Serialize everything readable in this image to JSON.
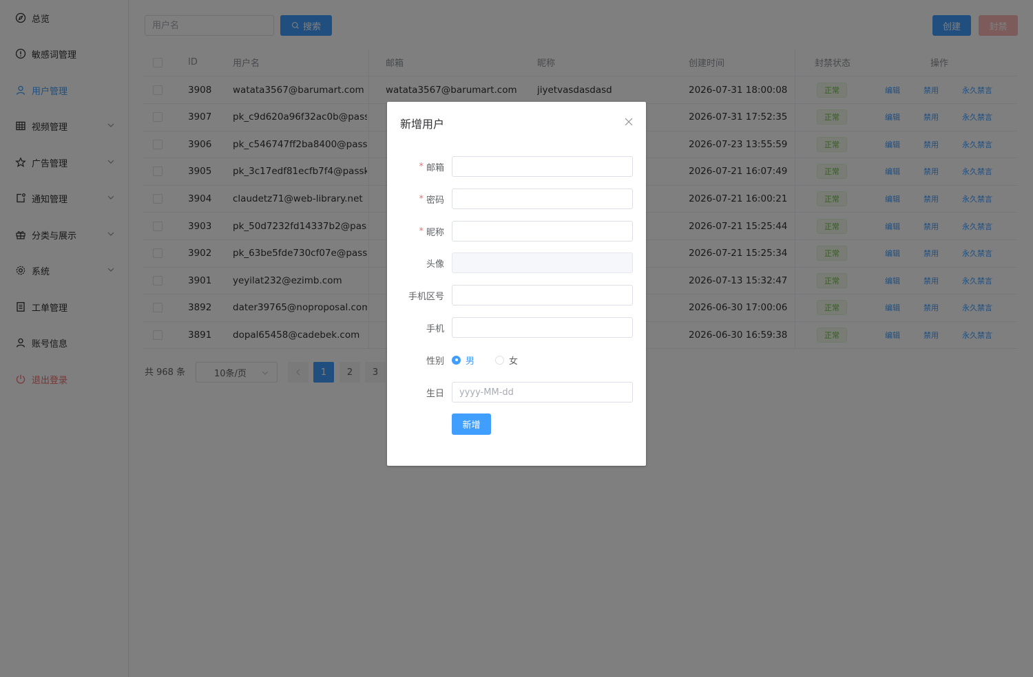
{
  "sidebar": {
    "items": [
      {
        "label": "总览",
        "icon": "compass-icon"
      },
      {
        "label": "敏感词管理",
        "icon": "warning-icon"
      },
      {
        "label": "用户管理",
        "icon": "user-icon",
        "active": true
      },
      {
        "label": "视频管理",
        "icon": "grid-icon",
        "expandable": true
      },
      {
        "label": "广告管理",
        "icon": "star-icon",
        "expandable": true
      },
      {
        "label": "通知管理",
        "icon": "notification-icon",
        "expandable": true
      },
      {
        "label": "分类与展示",
        "icon": "present-icon",
        "expandable": true
      },
      {
        "label": "系统",
        "icon": "gear-icon",
        "expandable": true
      },
      {
        "label": "工单管理",
        "icon": "document-icon"
      },
      {
        "label": "账号信息",
        "icon": "user-icon"
      },
      {
        "label": "退出登录",
        "icon": "power-icon",
        "danger": true
      }
    ]
  },
  "toolbar": {
    "search_placeholder": "用户名",
    "search_label": "搜索",
    "create_label": "创建",
    "ban_label": "封禁"
  },
  "table": {
    "headers": {
      "id": "ID",
      "username": "用户名",
      "email": "邮箱",
      "nickname": "昵称",
      "created": "创建时间",
      "status": "封禁状态",
      "actions": "操作"
    },
    "action_labels": {
      "edit": "编辑",
      "disable": "禁用",
      "mute": "永久禁言"
    },
    "rows": [
      {
        "id": "3908",
        "username": "watata3567@barumart.com",
        "email": "watata3567@barumart.com",
        "nickname": "jiyetvasdasdasd",
        "created": "2026-07-31 18:00:08",
        "status": "正常"
      },
      {
        "id": "3907",
        "username": "pk_c9d620a96f32ac0b@pass...",
        "email": "",
        "nickname": "",
        "created": "2026-07-31 17:52:35",
        "status": "正常"
      },
      {
        "id": "3906",
        "username": "pk_c546747ff2ba8400@pass...",
        "email": "",
        "nickname": "",
        "created": "2026-07-23 13:55:59",
        "status": "正常"
      },
      {
        "id": "3905",
        "username": "pk_3c17edf81ecfb7f4@passke...",
        "email": "",
        "nickname": "",
        "created": "2026-07-21 16:07:49",
        "status": "正常"
      },
      {
        "id": "3904",
        "username": "claudetz71@web-library.net",
        "email": "",
        "nickname": "",
        "created": "2026-07-21 16:00:21",
        "status": "正常"
      },
      {
        "id": "3903",
        "username": "pk_50d7232fd14337b2@pass...",
        "email": "",
        "nickname": "",
        "created": "2026-07-21 15:25:44",
        "status": "正常"
      },
      {
        "id": "3902",
        "username": "pk_63be5fde730cf07e@passk...",
        "email": "",
        "nickname": "",
        "created": "2026-07-21 15:25:34",
        "status": "正常"
      },
      {
        "id": "3901",
        "username": "yeyilat232@ezimb.com",
        "email": "",
        "nickname": "",
        "created": "2026-07-13 15:32:47",
        "status": "正常"
      },
      {
        "id": "3892",
        "username": "dater39765@noproposal.com",
        "email": "",
        "nickname": "",
        "created": "2026-06-30 17:00:06",
        "status": "正常"
      },
      {
        "id": "3891",
        "username": "dopal65458@cadebek.com",
        "email": "",
        "nickname": "",
        "created": "2026-06-30 16:59:38",
        "status": "正常"
      }
    ]
  },
  "pagination": {
    "total_text": "共 968 条",
    "page_size": "10条/页",
    "pages": [
      "1",
      "2",
      "3"
    ],
    "current": "1"
  },
  "dialog": {
    "title": "新增用户",
    "fields": {
      "email": {
        "label": "邮箱",
        "required": true,
        "value": ""
      },
      "password": {
        "label": "密码",
        "required": true,
        "value": ""
      },
      "nickname": {
        "label": "昵称",
        "required": true,
        "value": ""
      },
      "avatar": {
        "label": "头像",
        "disabled": true
      },
      "area_code": {
        "label": "手机区号",
        "value": ""
      },
      "phone": {
        "label": "手机",
        "value": ""
      },
      "gender": {
        "label": "性别",
        "options": [
          "男",
          "女"
        ],
        "selected": "男"
      },
      "birthday": {
        "label": "生日",
        "placeholder": "yyyy-MM-dd"
      }
    },
    "submit_label": "新增"
  },
  "colors": {
    "primary": "#409eff",
    "danger": "#f56c6c",
    "success": "#67c23a"
  }
}
